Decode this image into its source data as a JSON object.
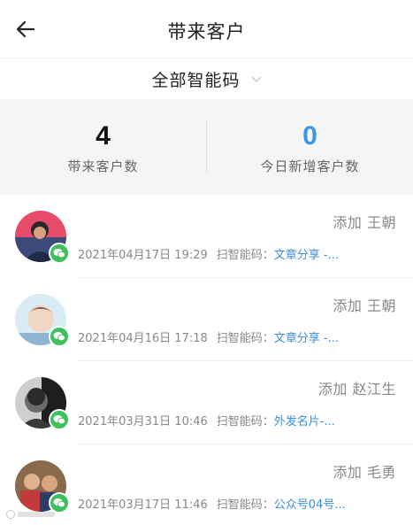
{
  "header": {
    "title": "带来客户",
    "back_icon": "back-arrow-icon"
  },
  "filter": {
    "label": "全部智能码",
    "icon": "chevron-down-icon"
  },
  "stats": [
    {
      "value": "4",
      "label": "带来客户数",
      "color": "#111111"
    },
    {
      "value": "0",
      "label": "今日新增客户数",
      "color": "#3a96e8"
    }
  ],
  "customers": [
    {
      "action": "添加 王朝",
      "time": "2021年04月17日 19:29",
      "scan_label": "扫智能码：",
      "code": "文章分享 -..."
    },
    {
      "action": "添加 王朝",
      "time": "2021年04月16日 17:18",
      "scan_label": "扫智能码：",
      "code": "文章分享 -..."
    },
    {
      "action": "添加 赵江生",
      "time": "2021年03月31日 10:46",
      "scan_label": "扫智能码：",
      "code": "外发名片-..."
    },
    {
      "action": "添加 毛勇",
      "time": "2021年03月17日 11:46",
      "scan_label": "扫智能码：",
      "code": "公众号04号..."
    }
  ],
  "colors": {
    "accent_blue": "#3a96e8",
    "wechat_green": "#3fc05d",
    "stats_bg": "#f5f5f5"
  }
}
